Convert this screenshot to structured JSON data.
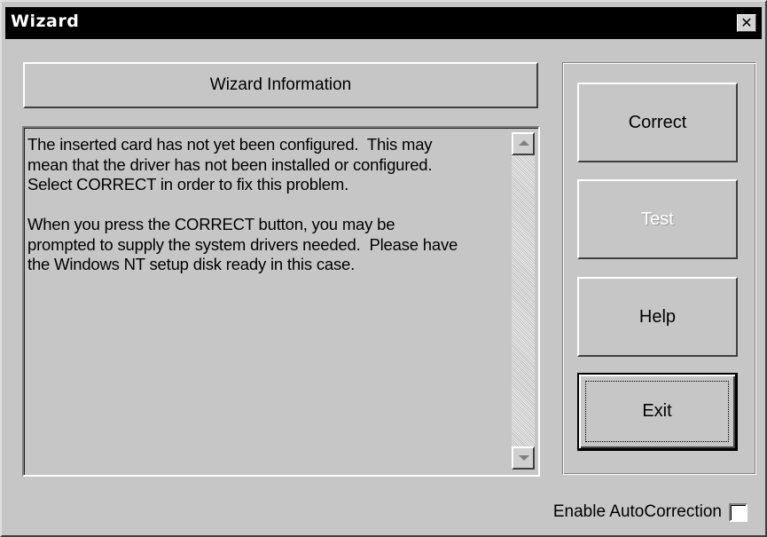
{
  "window": {
    "title": "Wizard",
    "close_glyph": "✕"
  },
  "info": {
    "header": "Wizard Information",
    "body": "The inserted card has not yet been configured.  This may\nmean that the driver has not been installed or configured.\nSelect CORRECT in order to fix this problem.\n\nWhen you press the CORRECT button, you may be\nprompted to supply the system drivers needed.  Please have\nthe Windows NT setup disk ready in this case."
  },
  "buttons": {
    "correct": "Correct",
    "test": "Test",
    "help": "Help",
    "exit": "Exit"
  },
  "options": {
    "auto_correction_label": "Enable AutoCorrection",
    "auto_correction_checked": false
  },
  "icons": {
    "close": "close-icon",
    "scroll_up": "scroll-up-arrow-icon",
    "scroll_down": "scroll-down-arrow-icon"
  },
  "colors": {
    "face": "#c6c6c6",
    "titlebar": "#000000",
    "disabled_text": "#ffffff"
  }
}
